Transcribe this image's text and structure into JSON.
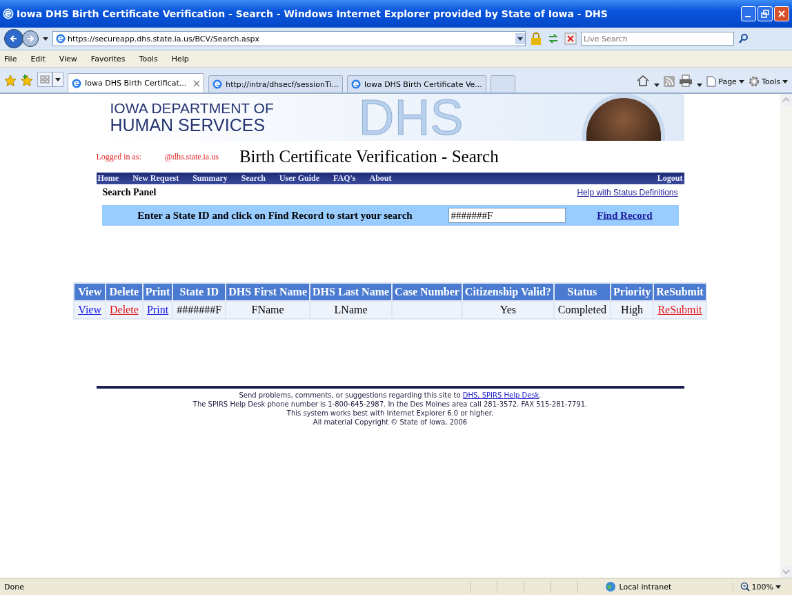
{
  "window": {
    "title": "Iowa DHS Birth Certificate Verification - Search - Windows Internet Explorer provided by State of Iowa - DHS"
  },
  "address": {
    "url": "https://secureapp.dhs.state.ia.us/BCV/Search.aspx"
  },
  "search": {
    "placeholder": "Live Search"
  },
  "menu": [
    "File",
    "Edit",
    "View",
    "Favorites",
    "Tools",
    "Help"
  ],
  "tabs": [
    {
      "label": "Iowa DHS Birth Certificat...",
      "selected": true
    },
    {
      "label": "http://intra/dhsecf/sessionTi...",
      "selected": false
    },
    {
      "label": "Iowa DHS Birth Certificate Ve...",
      "selected": false
    }
  ],
  "toolbar": {
    "page": "Page",
    "tools": "Tools"
  },
  "banner": {
    "line1": "IOWA DEPARTMENT OF",
    "line2": "HUMAN SERVICES",
    "watermark": "DHS"
  },
  "login": {
    "label": "Logged in as:",
    "value": "@dhs.state.ia.us"
  },
  "page_title": "Birth Certificate Verification - Search",
  "nav": [
    "Home",
    "New Request",
    "Summary",
    "Search",
    "User Guide",
    "FAQ's",
    "About"
  ],
  "logout": "Logout",
  "panel_title": "Search Panel",
  "help_link": "Help with Status Definitions",
  "search_panel": {
    "prompt": "Enter a State ID and click on Find Record to start your search",
    "value": "#######F",
    "button": "Find Record"
  },
  "table": {
    "columns": [
      "View",
      "Delete",
      "Print",
      "State ID",
      "DHS First Name",
      "DHS Last Name",
      "Case Number",
      "Citizenship Valid?",
      "Status",
      "Priority",
      "ReSubmit"
    ],
    "rows": [
      [
        {
          "kind": "link",
          "text": "View"
        },
        {
          "kind": "alert",
          "text": "Delete"
        },
        {
          "kind": "link",
          "text": "Print"
        },
        {
          "kind": "text",
          "text": "#######F"
        },
        {
          "kind": "text",
          "text": "FName"
        },
        {
          "kind": "text",
          "text": "LName"
        },
        {
          "kind": "text",
          "text": ""
        },
        {
          "kind": "text",
          "text": "Yes"
        },
        {
          "kind": "text",
          "text": "Completed"
        },
        {
          "kind": "text",
          "text": "High"
        },
        {
          "kind": "alert",
          "text": "ReSubmit"
        }
      ]
    ]
  },
  "footer": {
    "line1": "Send problems, comments, or suggestions regarding this site to",
    "link": "DHS, SPIRS Help Desk",
    "line1_end": ".",
    "lines": [
      "The SPIRS Help Desk phone number is 1-800-645-2987.  In the Des Moines area call 281-3572.  FAX 515-281-7791.",
      "This system works best with Internet Explorer 6.0 or higher.",
      "All material Copyright © State of Iowa, 2006"
    ]
  },
  "status_bar": {
    "text": "Done",
    "zone": "Local intranet",
    "zoom": "100%"
  }
}
